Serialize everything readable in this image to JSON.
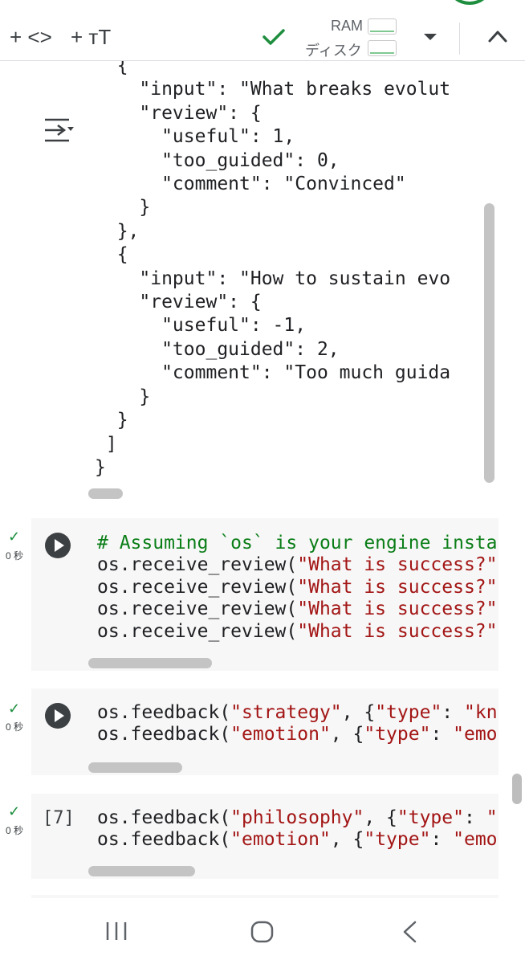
{
  "toolbar": {
    "add_code_label": "+ <>",
    "add_text_label": "+ тT",
    "ram_label": "RAM",
    "disk_label": "ディスク",
    "icons": [
      "check-icon",
      "chevron-down-icon",
      "chevron-up-icon"
    ]
  },
  "output": {
    "lines": [
      "  {",
      "    \"input\": \"What breaks evolut",
      "    \"review\": {",
      "      \"useful\": 1,",
      "      \"too_guided\": 0,",
      "      \"comment\": \"Convinced\"",
      "    }",
      "  },",
      "  {",
      "    \"input\": \"How to sustain evo",
      "    \"review\": {",
      "      \"useful\": -1,",
      "      \"too_guided\": 2,",
      "      \"comment\": \"Too much guida",
      "    }",
      "  }",
      " ]",
      "}"
    ]
  },
  "cells": [
    {
      "status_check": "✓",
      "status_time": "0 秒",
      "exec_count": "",
      "lines": [
        [
          {
            "t": "# Assuming `os` is your engine instanc",
            "c": "comment"
          }
        ],
        [
          {
            "t": "os.receive_review(",
            "c": "plain"
          },
          {
            "t": "\"What is success?\"",
            "c": "str"
          },
          {
            "t": ",",
            "c": "plain"
          }
        ],
        [
          {
            "t": "os.receive_review(",
            "c": "plain"
          },
          {
            "t": "\"What is success?\"",
            "c": "str"
          },
          {
            "t": ",",
            "c": "plain"
          }
        ],
        [
          {
            "t": "os.receive_review(",
            "c": "plain"
          },
          {
            "t": "\"What is success?\"",
            "c": "str"
          },
          {
            "t": ",",
            "c": "plain"
          }
        ],
        [
          {
            "t": "os.receive_review(",
            "c": "plain"
          },
          {
            "t": "\"What is success?\"",
            "c": "str"
          },
          {
            "t": ",",
            "c": "plain"
          }
        ]
      ]
    },
    {
      "status_check": "✓",
      "status_time": "0 秒",
      "exec_count": "",
      "lines": [
        [
          {
            "t": "os.feedback(",
            "c": "plain"
          },
          {
            "t": "\"strategy\"",
            "c": "str"
          },
          {
            "t": ", {",
            "c": "plain"
          },
          {
            "t": "\"type\"",
            "c": "str"
          },
          {
            "t": ": ",
            "c": "plain"
          },
          {
            "t": "\"know",
            "c": "str"
          }
        ],
        [
          {
            "t": "os.feedback(",
            "c": "plain"
          },
          {
            "t": "\"emotion\"",
            "c": "str"
          },
          {
            "t": ", {",
            "c": "plain"
          },
          {
            "t": "\"type\"",
            "c": "str"
          },
          {
            "t": ": ",
            "c": "plain"
          },
          {
            "t": "\"emoti",
            "c": "str"
          }
        ]
      ]
    },
    {
      "status_check": "✓",
      "status_time": "0 秒",
      "exec_count": "[7]",
      "lines": [
        [
          {
            "t": "os.feedback(",
            "c": "plain"
          },
          {
            "t": "\"philosophy\"",
            "c": "str"
          },
          {
            "t": ", {",
            "c": "plain"
          },
          {
            "t": "\"type\"",
            "c": "str"
          },
          {
            "t": ": ",
            "c": "plain"
          },
          {
            "t": "\"kr",
            "c": "str"
          }
        ],
        [
          {
            "t": "os.feedback(",
            "c": "plain"
          },
          {
            "t": "\"emotion\"",
            "c": "str"
          },
          {
            "t": ", {",
            "c": "plain"
          },
          {
            "t": "\"type\"",
            "c": "str"
          },
          {
            "t": ": ",
            "c": "plain"
          },
          {
            "t": "\"emoti",
            "c": "str"
          }
        ]
      ]
    }
  ],
  "navbar": {
    "icons": [
      "recent-apps-icon",
      "home-icon",
      "back-icon"
    ]
  },
  "colors": {
    "success_green": "#1e8e3e",
    "comment_green": "#0b7e18",
    "string_red": "#a31515",
    "cell_bg": "#f7f7f7"
  }
}
